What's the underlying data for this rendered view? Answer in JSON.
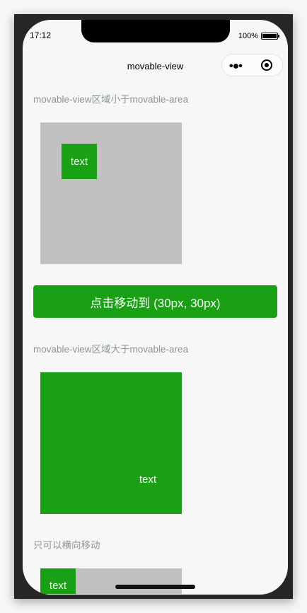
{
  "status_bar": {
    "time": "17:12",
    "battery": "100%"
  },
  "nav": {
    "title": "movable-view",
    "more_icon": "more-dots-icon",
    "close_icon": "target-circle-icon"
  },
  "sections": [
    {
      "label": "movable-view区域小于movable-area",
      "view_text": "text"
    },
    {
      "button": "点击移动到 (30px, 30px)"
    },
    {
      "label": "movable-view区域大于movable-area",
      "view_text": "text"
    },
    {
      "label": "只可以横向移动",
      "view_text": "text"
    }
  ],
  "colors": {
    "accent": "#1aa014",
    "area": "#c1c1c1"
  }
}
